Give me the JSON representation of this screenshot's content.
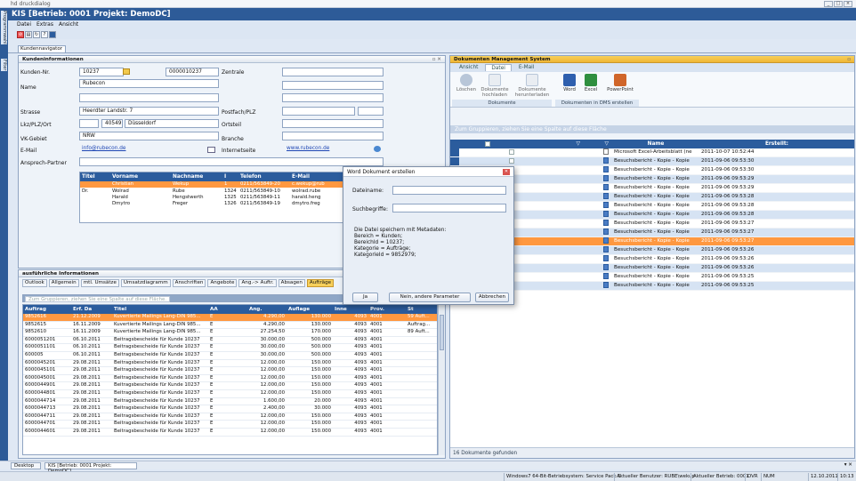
{
  "outer_title": "hd druckdialog",
  "app_title": "KIS [Betrieb: 0001 Projekt: DemoDC]",
  "side_tabs": [
    "Programmwahl",
    "Filter"
  ],
  "menu": [
    "Datei",
    "Extras",
    "Ansicht"
  ],
  "nav_tab": "Kundennavigator",
  "kunde": {
    "header": "Kundeninformationen",
    "labels": {
      "kundennr": "Kunden-Nr.",
      "name": "Name",
      "strasse": "Strasse",
      "lkz": "Lkz/PLZ/Ort",
      "vk": "VK-Gebiet",
      "email": "E-Mail",
      "ansprech": "Ansprech-Partner",
      "zentrale": "Zentrale",
      "postfach": "Postfach/PLZ",
      "ortsteil": "Ortsteil",
      "branche": "Branche",
      "internet": "Internetseite"
    },
    "values": {
      "kundennr": "10237",
      "kundennr2": "0000010237",
      "name": "Rubecon",
      "strasse": "Heerdter Landstr. 7",
      "plz": "40549",
      "ort": "Düsseldorf",
      "vk": "NRW",
      "email": "info@rubecon.de",
      "internet": "www.rubecon.de"
    }
  },
  "contacts": {
    "headers": [
      "Titel",
      "Vorname",
      "Nachname",
      "I",
      "Telefon",
      "E-Mail"
    ],
    "rows": [
      [
        "",
        "Christian",
        "Wekup",
        "1",
        "0211/563849-20",
        "c.wekup@rub"
      ],
      [
        "Dr.",
        "Wolrad",
        "Rube",
        "1324",
        "0211/563849-10",
        "wolrad.rube"
      ],
      [
        "",
        "Harald",
        "Hengstwerth",
        "1325",
        "0211/563849-11",
        "harald.heng"
      ],
      [
        "",
        "Dmytro",
        "Freger",
        "1326",
        "0211/563849-19",
        "dmytro.freg"
      ]
    ]
  },
  "details": {
    "header": "ausführliche Informationen",
    "tabs": [
      "Outlook",
      "Allgemein",
      "mtl. Umsätze",
      "Umsatzdiagramm",
      "Anschriften",
      "Angebote",
      "Ang.-> Auftr.",
      "Absagen",
      "Aufträge"
    ],
    "active_tab": "Aufträge",
    "group_hint": "Zum Gruppieren, ziehen Sie eine Spalte auf diese Fläche.",
    "headers": [
      "Auftrag",
      "Erf. Da",
      "Titel",
      "AA",
      "Ang.",
      "Auflage",
      "Inne",
      "Prov.",
      "St"
    ],
    "rows": [
      [
        "9852616",
        "21.12.2009",
        "Kuvertierte Mailings Lang-DIN 985...",
        "E",
        "4.290,00",
        "130.000",
        "4093",
        "4001",
        "59 Auft..."
      ],
      [
        "9852615",
        "16.11.2009",
        "Kuvertierte Mailings Lang-DIN 985...",
        "E",
        "4.290,00",
        "130.000",
        "4093",
        "4001",
        "Auftrag..."
      ],
      [
        "9852610",
        "16.11.2009",
        "Kuvertierte Mailings Lang-DIN 985...",
        "E",
        "27.254,50",
        "170.000",
        "4093",
        "4001",
        "89 Auft..."
      ],
      [
        "6000051201",
        "06.10.2011",
        "Beitragsbescheide für Kunde 10237",
        "E",
        "30.000,00",
        "500.000",
        "4093",
        "4001",
        ""
      ],
      [
        "6000051101",
        "06.10.2011",
        "Beitragsbescheide für Kunde 10237",
        "E",
        "30.000,00",
        "500.000",
        "4093",
        "4001",
        ""
      ],
      [
        "600005",
        "06.10.2011",
        "Beitragsbescheide für Kunde 10237",
        "E",
        "30.000,00",
        "500.000",
        "4093",
        "4001",
        ""
      ],
      [
        "6000045201",
        "29.08.2011",
        "Beitragsbescheide für Kunde 10237",
        "E",
        "12.000,00",
        "150.000",
        "4093",
        "4001",
        ""
      ],
      [
        "6000045101",
        "29.08.2011",
        "Beitragsbescheide für Kunde 10237",
        "E",
        "12.000,00",
        "150.000",
        "4093",
        "4001",
        ""
      ],
      [
        "6000045001",
        "29.08.2011",
        "Beitragsbescheide für Kunde 10237",
        "E",
        "12.000,00",
        "150.000",
        "4093",
        "4001",
        ""
      ],
      [
        "6000044901",
        "29.08.2011",
        "Beitragsbescheide für Kunde 10237",
        "E",
        "12.000,00",
        "150.000",
        "4093",
        "4001",
        ""
      ],
      [
        "6000044801",
        "29.08.2011",
        "Beitragsbescheide für Kunde 10237",
        "E",
        "12.000,00",
        "150.000",
        "4093",
        "4001",
        ""
      ],
      [
        "6000044714",
        "29.08.2011",
        "Beitragsbescheide für Kunde 10237",
        "E",
        "1.600,00",
        "20.000",
        "4093",
        "4001",
        ""
      ],
      [
        "6000044713",
        "29.08.2011",
        "Beitragsbescheide für Kunde 10237",
        "E",
        "2.400,00",
        "30.000",
        "4093",
        "4001",
        ""
      ],
      [
        "6000044711",
        "29.08.2011",
        "Beitragsbescheide für Kunde 10237",
        "E",
        "12.000,00",
        "150.000",
        "4093",
        "4001",
        ""
      ],
      [
        "6000044701",
        "29.08.2011",
        "Beitragsbescheide für Kunde 10237",
        "E",
        "12.000,00",
        "150.000",
        "4093",
        "4001",
        ""
      ],
      [
        "6000044601",
        "29.08.2011",
        "Beitragsbescheide für Kunde 10237",
        "E",
        "12.000,00",
        "150.000",
        "4093",
        "4001",
        ""
      ]
    ]
  },
  "dms": {
    "header": "Dokumenten Management System",
    "tabs": [
      "Ansicht",
      "Datei",
      "E-Mail"
    ],
    "active_tab": "Datei",
    "ribbon": {
      "loeschen": "Löschen",
      "hochladen": "Dokumente hochladen",
      "herunterladen": "Dokumente herunterladen",
      "word": "Word",
      "excel": "Excel",
      "powerpoint": "PowerPoint",
      "group1": "Dokumente",
      "group2": "Dokumenten in DMS erstellen"
    },
    "group_hint": "Zum Gruppieren, ziehen Sie eine Spalte auf diese Fläche",
    "col_name": "Name",
    "col_erstellt": "Erstellt:",
    "rows": [
      [
        "Microsoft Excel-Arbeitsblatt (ne",
        "2011-10-07 10:52:44"
      ],
      [
        "Besuchsbericht - Kopie - Kopie",
        "2011-09-06 09:53:30"
      ],
      [
        "Besuchsbericht - Kopie - Kopie",
        "2011-09-06 09:53:30"
      ],
      [
        "Besuchsbericht - Kopie - Kopie",
        "2011-09-06 09:53:29"
      ],
      [
        "Besuchsbericht - Kopie - Kopie",
        "2011-09-06 09:53:29"
      ],
      [
        "Besuchsbericht - Kopie - Kopie",
        "2011-09-06 09:53:28"
      ],
      [
        "Besuchsbericht - Kopie - Kopie",
        "2011-09-06 09:53:28"
      ],
      [
        "Besuchsbericht - Kopie - Kopie",
        "2011-09-06 09:53:28"
      ],
      [
        "Besuchsbericht - Kopie - Kopie",
        "2011-09-06 09:53:27"
      ],
      [
        "Besuchsbericht - Kopie - Kopie",
        "2011-09-06 09:53:27"
      ],
      [
        "Besuchsbericht - Kopie - Kopie",
        "2011-09-06 09:53:27"
      ],
      [
        "Besuchsbericht - Kopie - Kopie",
        "2011-09-06 09:53:26"
      ],
      [
        "Besuchsbericht - Kopie - Kopie",
        "2011-09-06 09:53:26"
      ],
      [
        "Besuchsbericht - Kopie - Kopie",
        "2011-09-06 09:53:26"
      ],
      [
        "Besuchsbericht - Kopie - Kopie",
        "2011-09-06 09:53:25"
      ],
      [
        "Besuchsbericht - Kopie - Kopie",
        "2011-09-06 09:53:25"
      ]
    ],
    "footer": "16 Dokumente gefunden"
  },
  "dialog": {
    "title": "Word Dokument erstellen",
    "dateiname": "Dateiname:",
    "suchbegriffe": "Suchbegriffe:",
    "info": "Die Datei speichern mit Metadaten:\nBereich = Kunden;\nBereichId = 10237;\nKategorie = Aufträge;\nKategorieId = 9852979;",
    "btn_ja": "Ja",
    "btn_nein": "Nein, andere Parameter",
    "btn_abbrechen": "Abbrechen"
  },
  "taskbar": {
    "desktop": "Desktop",
    "kis": "KIS [Betrieb: 0001 Projekt: DemoDC]"
  },
  "status": [
    "Windows7 64-Bit-Betriebsystem: Service Pack 1",
    "Aktueller Benutzer: RUBE\\wekup",
    "Aktueller Betrieb: 0001",
    "OVR",
    "NUM",
    "12.10.2011",
    "10:13"
  ]
}
